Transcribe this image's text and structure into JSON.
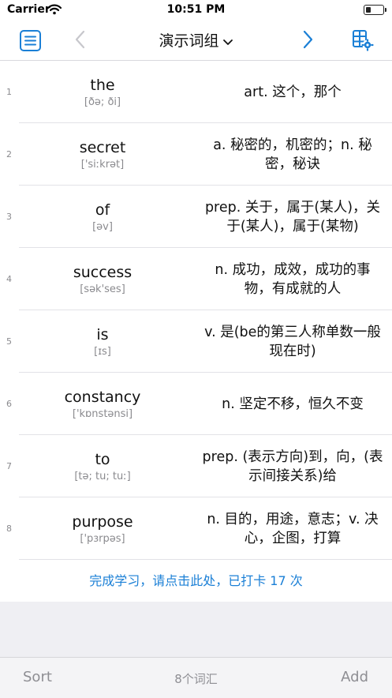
{
  "status": {
    "carrier": "Carrier",
    "time": "10:51 PM"
  },
  "nav": {
    "title": "演示词组",
    "accent_color": "#1a7fd6",
    "disabled_color": "#c7c7cc"
  },
  "words": [
    {
      "num": "1",
      "word": "the",
      "phonetic": "[ðə; ði]",
      "meaning": "art. 这个，那个"
    },
    {
      "num": "2",
      "word": "secret",
      "phonetic": "['siːkrət]",
      "meaning": "a. 秘密的，机密的；n. 秘密，秘诀"
    },
    {
      "num": "3",
      "word": "of",
      "phonetic": "[əv]",
      "meaning": "prep. 关于，属于(某人)，关于(某人)，属于(某物)"
    },
    {
      "num": "4",
      "word": "success",
      "phonetic": "[sək'ses]",
      "meaning": "n. 成功，成效，成功的事物，有成就的人"
    },
    {
      "num": "5",
      "word": "is",
      "phonetic": "[ɪs]",
      "meaning": "v. 是(be的第三人称单数一般现在时)"
    },
    {
      "num": "6",
      "word": "constancy",
      "phonetic": "['kɒnstənsi]",
      "meaning": "n. 坚定不移，恒久不变"
    },
    {
      "num": "7",
      "word": "to",
      "phonetic": "[tə; tu; tuː]",
      "meaning": "prep. (表示方向)到，向，(表示间接关系)给"
    },
    {
      "num": "8",
      "word": "purpose",
      "phonetic": "['pɜrpəs]",
      "meaning": "n. 目的，用途，意志；v. 决心，企图，打算"
    }
  ],
  "footer_link": "完成学习，请点击此处，已打卡 17 次",
  "toolbar": {
    "sort_label": "Sort",
    "count_label": "8个词汇",
    "add_label": "Add"
  },
  "icons": {
    "list": "list-icon",
    "back": "chevron-left-icon",
    "forward": "chevron-right-icon",
    "settings": "grid-settings-icon",
    "dropdown": "chevron-down-icon",
    "wifi": "wifi-icon",
    "battery": "battery-icon"
  }
}
